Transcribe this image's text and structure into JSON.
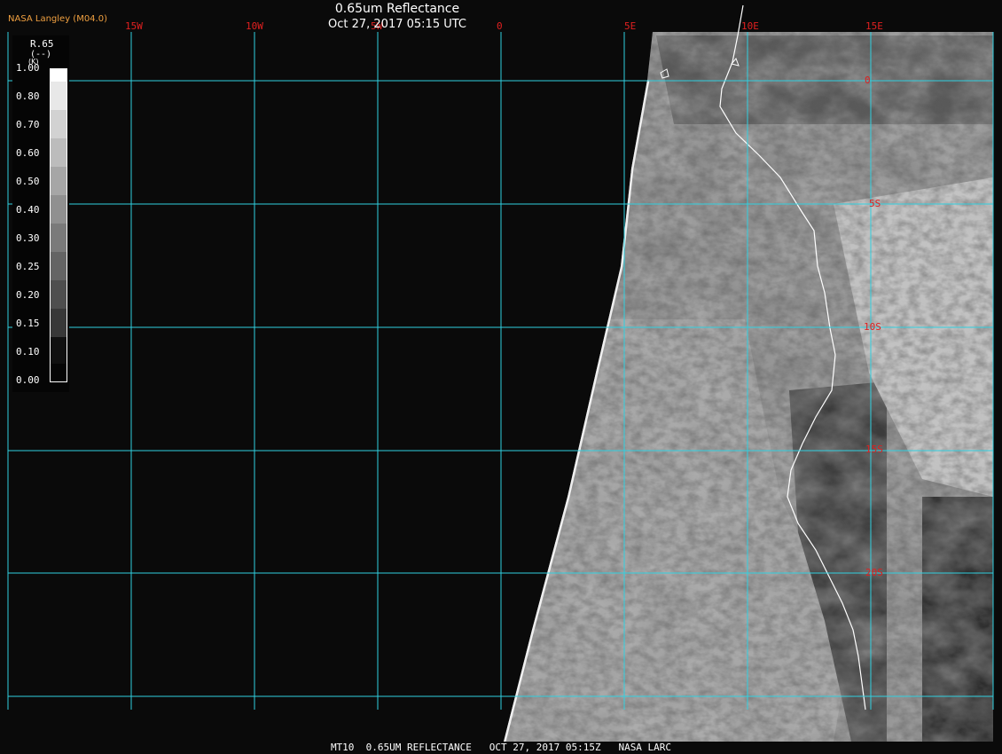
{
  "header": {
    "agency": "NASA Langley (M04.0)",
    "title": "0.65um Reflectance",
    "timestamp": "Oct 27, 2017 05:15 UTC"
  },
  "grid": {
    "longitude_labels": [
      "15W",
      "10W",
      "5W",
      "0",
      "5E",
      "10E",
      "15E"
    ],
    "latitude_labels": [
      "0",
      "5S",
      "10S",
      "15S",
      "20S"
    ],
    "color": "#30d0e0",
    "label_color": "#e02020"
  },
  "legend": {
    "variable": "R.65",
    "unit": "(--)",
    "unit_k": "(K)",
    "labels": [
      "1.00",
      "0.80",
      "0.70",
      "0.60",
      "0.50",
      "0.40",
      "0.30",
      "0.25",
      "0.20",
      "0.15",
      "0.10",
      "0.00"
    ]
  },
  "footer": {
    "caption": "MT10  0.65UM REFLECTANCE   OCT 27, 2017 05:15Z   NASA LARC"
  },
  "colors": {
    "background": "#0a0a0a",
    "coastline": "#ffffff"
  }
}
